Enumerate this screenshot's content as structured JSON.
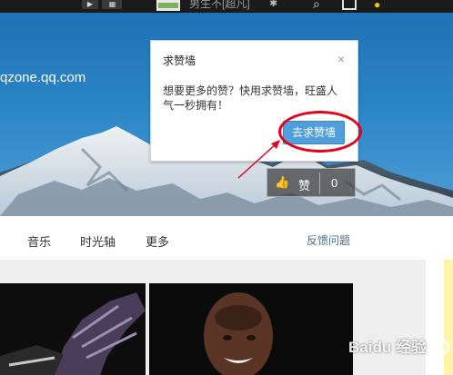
{
  "topbar": {
    "play_icon": "▶",
    "grid_icon": "▦",
    "user_name": "男生不[超凡]",
    "gear_icon": "✱",
    "search_icon": "⌕",
    "yellow_icon": "●"
  },
  "banner": {
    "url": "qzone.qq.com"
  },
  "popup": {
    "title": "求赞墙",
    "close": "×",
    "message": "想要更多的赞？快用求赞墙，旺盛人气一秒拥有！",
    "button": "去求赞墙"
  },
  "like": {
    "thumb_icon": "👍",
    "label": "赞",
    "count": "0"
  },
  "nav": {
    "items": [
      "音乐",
      "时光轴",
      "更多"
    ],
    "feedback": "反馈问题"
  },
  "watermark": {
    "text": "Baidu 经验"
  },
  "colors": {
    "accent": "#4f9fdc",
    "highlight": "#e4001c"
  }
}
